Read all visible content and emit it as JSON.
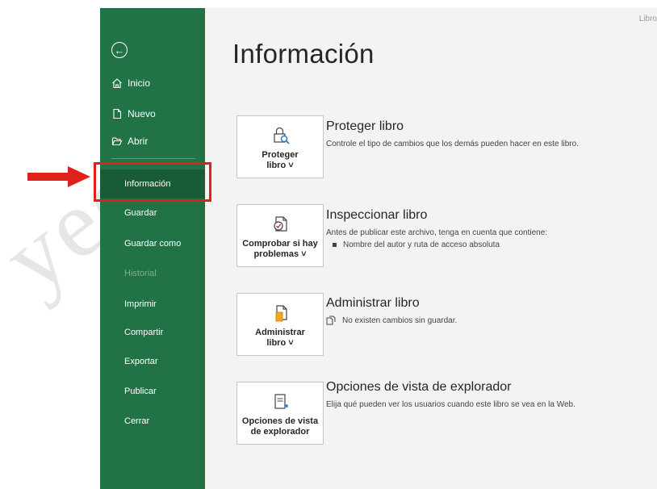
{
  "sidebar": {
    "top_items": [
      {
        "label": "Inicio",
        "icon": "home-icon"
      },
      {
        "label": "Nuevo",
        "icon": "new-document-icon"
      },
      {
        "label": "Abrir",
        "icon": "open-folder-icon"
      }
    ],
    "items": [
      {
        "label": "Información",
        "selected": true
      },
      {
        "label": "Guardar"
      },
      {
        "label": "Guardar como"
      },
      {
        "label": "Historial",
        "disabled": true
      },
      {
        "label": "Imprimir"
      },
      {
        "label": "Compartir"
      },
      {
        "label": "Exportar"
      },
      {
        "label": "Publicar"
      },
      {
        "label": "Cerrar"
      }
    ],
    "color": "#217346"
  },
  "main": {
    "title": "Información",
    "top_right_hint": "Libro",
    "sections": [
      {
        "card_label": "Proteger\nlibro ˅",
        "icon": "lock-search-icon",
        "title": "Proteger libro",
        "description": "Controle el tipo de cambios que los demás pueden hacer en este libro."
      },
      {
        "card_label": "Comprobar si hay\nproblemas ˅",
        "icon": "inspect-document-icon",
        "title": "Inspeccionar libro",
        "description": "Antes de publicar este archivo, tenga en cuenta que contiene:",
        "bullet": "Nombre del autor y ruta de acceso absoluta"
      },
      {
        "card_label": "Administrar\nlibro ˅",
        "icon": "manage-workbook-icon",
        "title": "Administrar libro",
        "description": "No existen cambios sin guardar."
      },
      {
        "card_label": "Opciones de vista\nde explorador",
        "icon": "browser-view-icon",
        "title": "Opciones de vista de explorador",
        "description": "Elija qué pueden ver los usuarios cuando este libro se vea en la Web."
      }
    ]
  },
  "annotation": {
    "highlight_color": "#e0201b"
  },
  "watermark": "yecto"
}
